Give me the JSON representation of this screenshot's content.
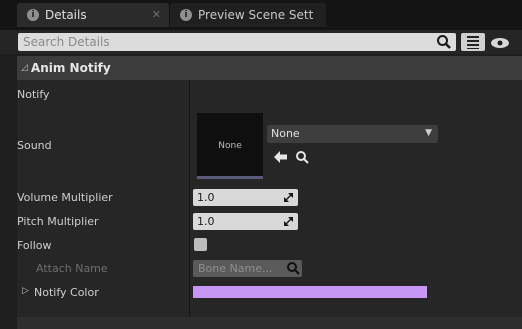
{
  "tabs": [
    {
      "label": "Details",
      "icon": "info-icon",
      "close": "✕"
    },
    {
      "label": "Preview Scene Sett",
      "icon": "info-icon"
    }
  ],
  "search": {
    "placeholder": "Search Details"
  },
  "category": {
    "label": "Anim Notify",
    "icon": "collapse-triangle-icon"
  },
  "properties": {
    "notify": {
      "label": "Notify"
    },
    "sound": {
      "label": "Sound",
      "thumbnail": "None",
      "selected": "None"
    },
    "volume": {
      "label": "Volume Multiplier",
      "value": "1.0"
    },
    "pitch": {
      "label": "Pitch Multiplier",
      "value": "1.0"
    },
    "follow": {
      "label": "Follow",
      "checked": false
    },
    "attach": {
      "label": "Attach Name",
      "placeholder": "Bone Name..."
    },
    "color": {
      "label": "Notify Color",
      "value": "#c896f5"
    }
  },
  "colors": {
    "accent": "#c896f5"
  }
}
